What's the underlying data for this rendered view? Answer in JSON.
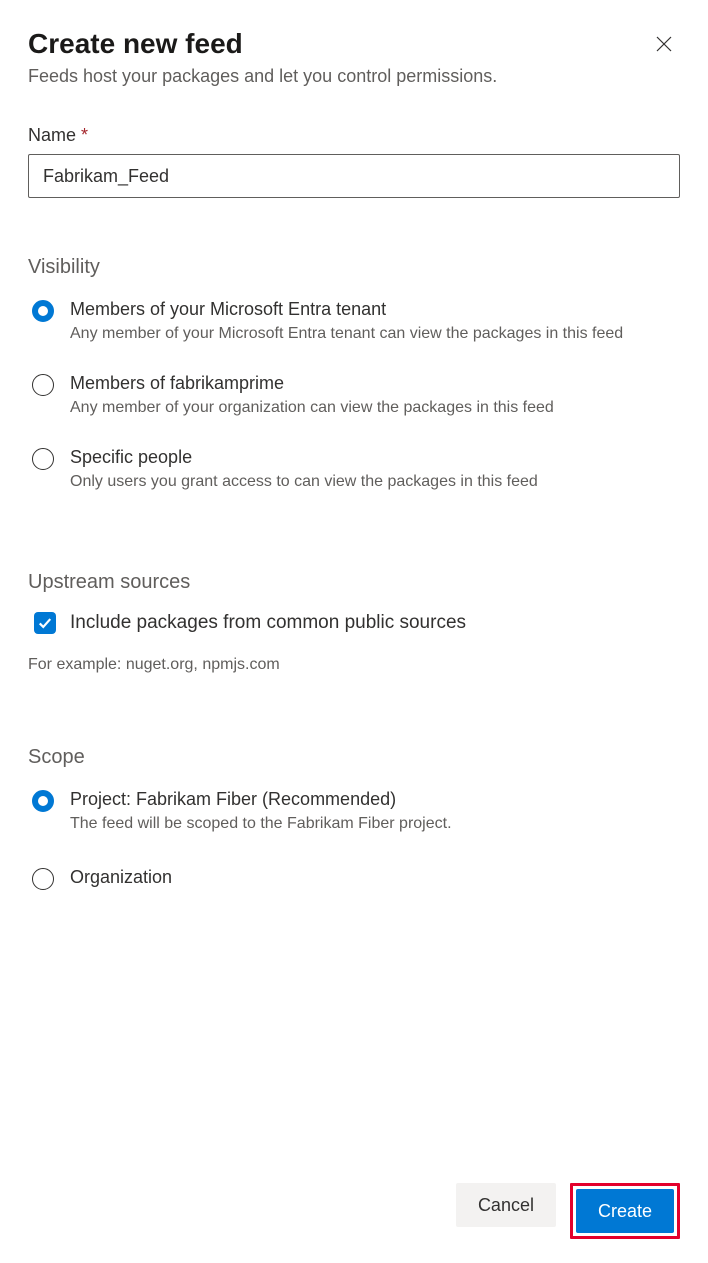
{
  "header": {
    "title": "Create new feed",
    "subtitle": "Feeds host your packages and let you control permissions."
  },
  "name_field": {
    "label": "Name",
    "required_mark": "*",
    "value": "Fabrikam_Feed"
  },
  "visibility": {
    "header": "Visibility",
    "options": [
      {
        "title": "Members of your Microsoft Entra tenant",
        "desc": "Any member of your Microsoft Entra tenant can view the packages in this feed"
      },
      {
        "title": "Members of fabrikamprime",
        "desc": "Any member of your organization can view the packages in this feed"
      },
      {
        "title": "Specific people",
        "desc": "Only users you grant access to can view the packages in this feed"
      }
    ]
  },
  "upstream": {
    "header": "Upstream sources",
    "checkbox_label": "Include packages from common public sources",
    "example": "For example: nuget.org, npmjs.com"
  },
  "scope": {
    "header": "Scope",
    "options": [
      {
        "title": "Project: Fabrikam Fiber (Recommended)",
        "desc": "The feed will be scoped to the Fabrikam Fiber project."
      },
      {
        "title": "Organization",
        "desc": ""
      }
    ]
  },
  "footer": {
    "cancel": "Cancel",
    "create": "Create"
  }
}
